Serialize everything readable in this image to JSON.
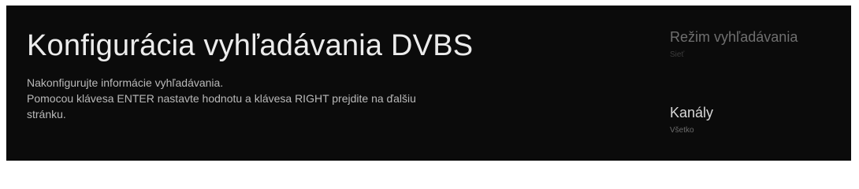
{
  "header": {
    "title": "Konfigurácia vyhľadávania DVBS",
    "description": [
      "Nakonfigurujte informácie vyhľadávania.",
      "Pomocou klávesa ENTER nastavte hodnotu a klávesa RIGHT prejdite na ďalšiu",
      "stránku."
    ]
  },
  "menu": {
    "items": [
      {
        "label": "Režim vyhľadávania",
        "value": "Sieť"
      },
      {
        "label": "Kanály",
        "value": "Všetko"
      }
    ]
  },
  "colors": {
    "background": "#0b0b0b",
    "title": "#ececec",
    "description": "#b9b9b9",
    "focused_item": "#d8d8d8",
    "unfocused_item": "#6f6f6f"
  }
}
